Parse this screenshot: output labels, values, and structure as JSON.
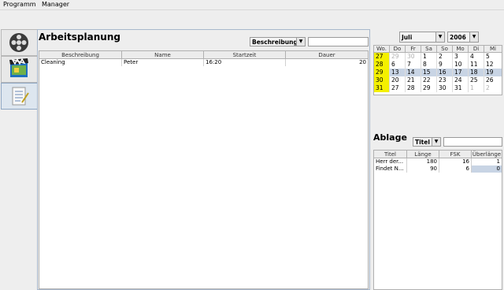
{
  "menu": [
    "Programm",
    "Manager"
  ],
  "sidebar": {
    "buttons": [
      {
        "name": "film-reel-icon"
      },
      {
        "name": "clapperboard-icon"
      },
      {
        "name": "notepad-icon"
      }
    ]
  },
  "arbeitsplanung": {
    "title": "Arbeitsplanung",
    "filter_combo": "Beschreibung",
    "search_value": "",
    "columns": [
      "Beschreibung",
      "Name",
      "Startzeit",
      "Dauer"
    ],
    "rows": [
      [
        "Cleaning",
        "Peter",
        "16:20",
        "20"
      ]
    ]
  },
  "calendar": {
    "month": "Juli",
    "year": "2006",
    "headers": [
      "Wo.",
      "Do",
      "Fr",
      "Sa",
      "So",
      "Mo",
      "Di",
      "Mi"
    ],
    "weeks": [
      {
        "wk": "27",
        "days": [
          "29",
          "30",
          "1",
          "2",
          "3",
          "4",
          "5"
        ],
        "grey": [
          true,
          true,
          false,
          false,
          false,
          false,
          false
        ],
        "selected": false
      },
      {
        "wk": "28",
        "days": [
          "6",
          "7",
          "8",
          "9",
          "10",
          "11",
          "12"
        ],
        "grey": [
          false,
          false,
          false,
          false,
          false,
          false,
          false
        ],
        "selected": false
      },
      {
        "wk": "29",
        "days": [
          "13",
          "14",
          "15",
          "16",
          "17",
          "18",
          "19"
        ],
        "grey": [
          false,
          false,
          false,
          false,
          false,
          false,
          false
        ],
        "selected": true
      },
      {
        "wk": "30",
        "days": [
          "20",
          "21",
          "22",
          "23",
          "24",
          "25",
          "26"
        ],
        "grey": [
          false,
          false,
          false,
          false,
          false,
          false,
          false
        ],
        "selected": false
      },
      {
        "wk": "31",
        "days": [
          "27",
          "28",
          "29",
          "30",
          "31",
          "1",
          "2"
        ],
        "grey": [
          false,
          false,
          false,
          false,
          false,
          true,
          true
        ],
        "selected": false
      }
    ]
  },
  "ablage": {
    "title": "Ablage",
    "filter_combo": "Titel",
    "search_value": "",
    "columns": [
      "Titel",
      "Länge",
      "FSK",
      "Überlänge"
    ],
    "rows": [
      [
        "Herr der...",
        "180",
        "16",
        "1"
      ],
      [
        "Findet N...",
        "90",
        "6",
        "0"
      ]
    ]
  },
  "colors": {
    "week_highlight": "#f4f000",
    "selection": "#c8d4e4",
    "panel_border": "#a8b8cc"
  }
}
